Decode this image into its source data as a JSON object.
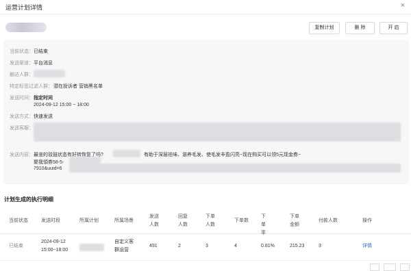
{
  "header": {
    "title": "运营计划详情",
    "close": "×"
  },
  "toolbar": {
    "copy_label": "复制计划",
    "delete_label": "删 除",
    "enable_label": "开 启"
  },
  "info": {
    "status": {
      "label": "当前状态：",
      "value": "已结束"
    },
    "channel": {
      "label": "发送渠道：",
      "value": "平台消息"
    },
    "audience": {
      "label": "触达人群：",
      "value": ""
    },
    "filter": {
      "label": "特定标签过滤人群：",
      "value": "潜在投诉者 营销黑名单"
    },
    "time": {
      "label": "发送时间：",
      "value_title": "指定时间",
      "value_range": "2024-09-12 15:00 ~ 18:00"
    },
    "method": {
      "label": "发送方式：",
      "value": "快速发送"
    },
    "account": {
      "label": "发送客服："
    },
    "content": {
      "label": "发送内容：",
      "line1a": "最宠的驳鼓状态有好转恢复了吗?",
      "line1b": "有助于深层祛味、滋养毛发、使毛发丰盈闪亮~现在购买可以领5元现金券~",
      "line2": "聚我領券58-5-",
      "line3": "7910&uuid=6"
    }
  },
  "section": {
    "title": "计划生成的执行明细"
  },
  "table": {
    "headers": {
      "status": "当前状态",
      "period": "发送时段",
      "plan": "所属计划",
      "scene": "所属场景",
      "senders": "发送人数",
      "replies": "回复人数",
      "buyers": "下单人数",
      "orders": "下单数",
      "rate": "下单率",
      "amount": "下单金额",
      "payers": "付款人数",
      "action": "操作"
    },
    "row": {
      "status": "已结束",
      "period_date": "2024-09-12",
      "period_time": "15:00~18:00",
      "plan": "",
      "scene_line1": "自定义客",
      "scene_line2": "群运营",
      "senders": "491",
      "replies": "2",
      "buyers": "3",
      "orders": "4",
      "rate": "0.81%",
      "amount": "215.23",
      "payers": "3",
      "action": "详情"
    }
  }
}
